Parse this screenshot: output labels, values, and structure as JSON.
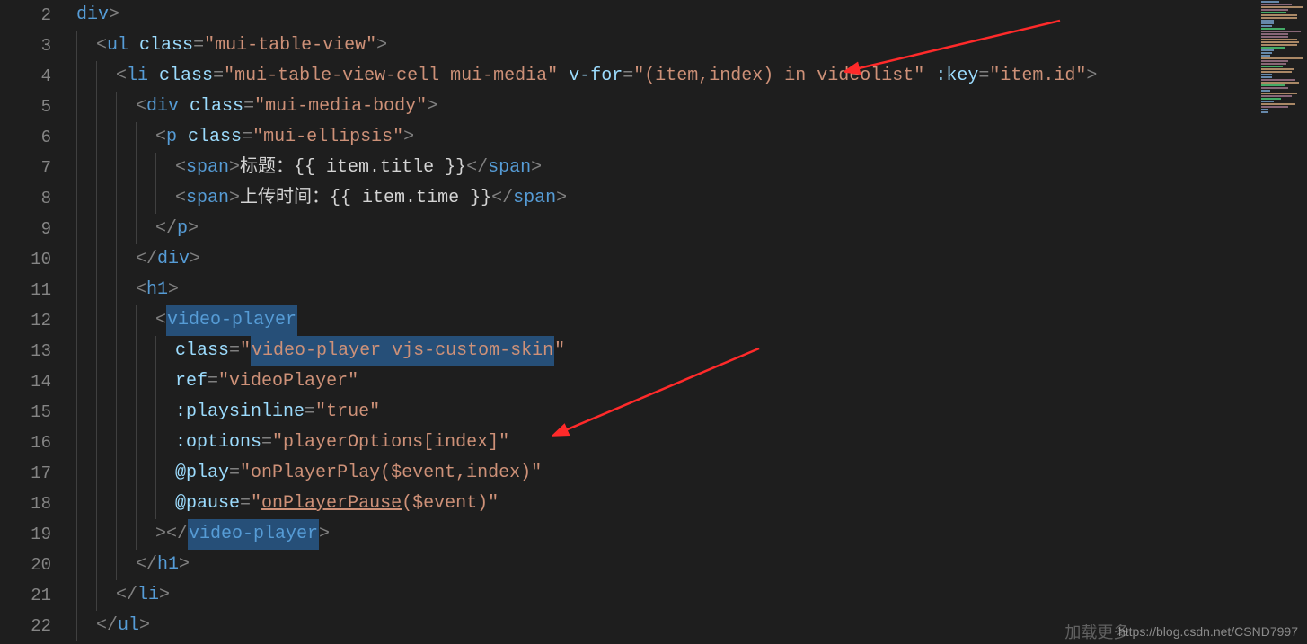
{
  "editor": {
    "lines": {
      "start": 2,
      "end": 22
    },
    "code": {
      "l2": {
        "text_div": "div",
        "gt": ">"
      },
      "l3": {
        "tag_ul": "ul",
        "attr_class": "class",
        "val_class": "mui-table-view"
      },
      "l4": {
        "tag_li": "li",
        "attr_class": "class",
        "val_class": "mui-table-view-cell mui-media",
        "attr_vfor": "v-for",
        "val_vfor": "(item,index) in videolist",
        "attr_key": ":key",
        "val_key": "item.id"
      },
      "l5": {
        "tag_div": "div",
        "attr_class": "class",
        "val_class": "mui-media-body"
      },
      "l6": {
        "tag_p": "p",
        "attr_class": "class",
        "val_class": "mui-ellipsis"
      },
      "l7": {
        "tag_span": "span",
        "txt": "标题：{{ item.title }}"
      },
      "l8": {
        "tag_span": "span",
        "txt": "上传时间：{{ item.time }}"
      },
      "l9": {
        "close_p": "p"
      },
      "l10": {
        "close_div": "div"
      },
      "l11": {
        "tag_h1": "h1"
      },
      "l12": {
        "tag_vp": "video-player"
      },
      "l13": {
        "attr_class": "class",
        "val_class": "video-player vjs-custom-skin"
      },
      "l14": {
        "attr_ref": "ref",
        "val_ref": "videoPlayer"
      },
      "l15": {
        "attr_pi": ":playsinline",
        "val_pi": "true"
      },
      "l16": {
        "attr_opt": ":options",
        "val_opt": "playerOptions[index]"
      },
      "l17": {
        "attr_play": "@play",
        "val_play": "onPlayerPlay($event,index)"
      },
      "l18": {
        "attr_pause": "@pause",
        "pre": "onPlayerPause",
        "post": "($event)"
      },
      "l19": {
        "close_vp": "video-player"
      },
      "l20": {
        "close_h1": "h1"
      },
      "l21": {
        "close_li": "li"
      },
      "l22": {
        "close_ul": "ul"
      },
      "l23_preview": "加载更多"
    },
    "watermark": "https://blog.csdn.net/CSND7997"
  }
}
